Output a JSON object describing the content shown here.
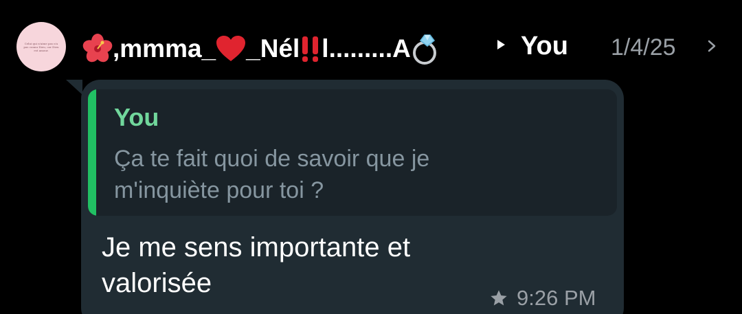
{
  "header": {
    "avatar_text": "Celui qui n'aime pas n'a pas connu Dieu, car Dieu est amour.",
    "sender_prefix": ",mmma_",
    "sender_mid": "_Nél",
    "sender_tail": "l.........A",
    "recipient": "You",
    "date": "1/4/25",
    "icons": [
      "hibiscus-emoji",
      "red-heart-emoji",
      "double-exclamation-emoji",
      "ring-emoji",
      "arrow-right-icon",
      "chevron-right-icon"
    ]
  },
  "message": {
    "quote": {
      "author": "You",
      "text": "Ça te fait quoi de savoir que je m'inquiète pour toi ?"
    },
    "body": "Je me sens importante et valorisée",
    "starred": true,
    "time": "9:26 PM"
  },
  "colors": {
    "background": "#000000",
    "bubble": "#202c33",
    "quote_bg": "#1a2329",
    "quote_bar": "#21c063",
    "quote_author": "#71d79c",
    "muted_text": "#8696a0",
    "meta_text": "#9aa0a6"
  }
}
